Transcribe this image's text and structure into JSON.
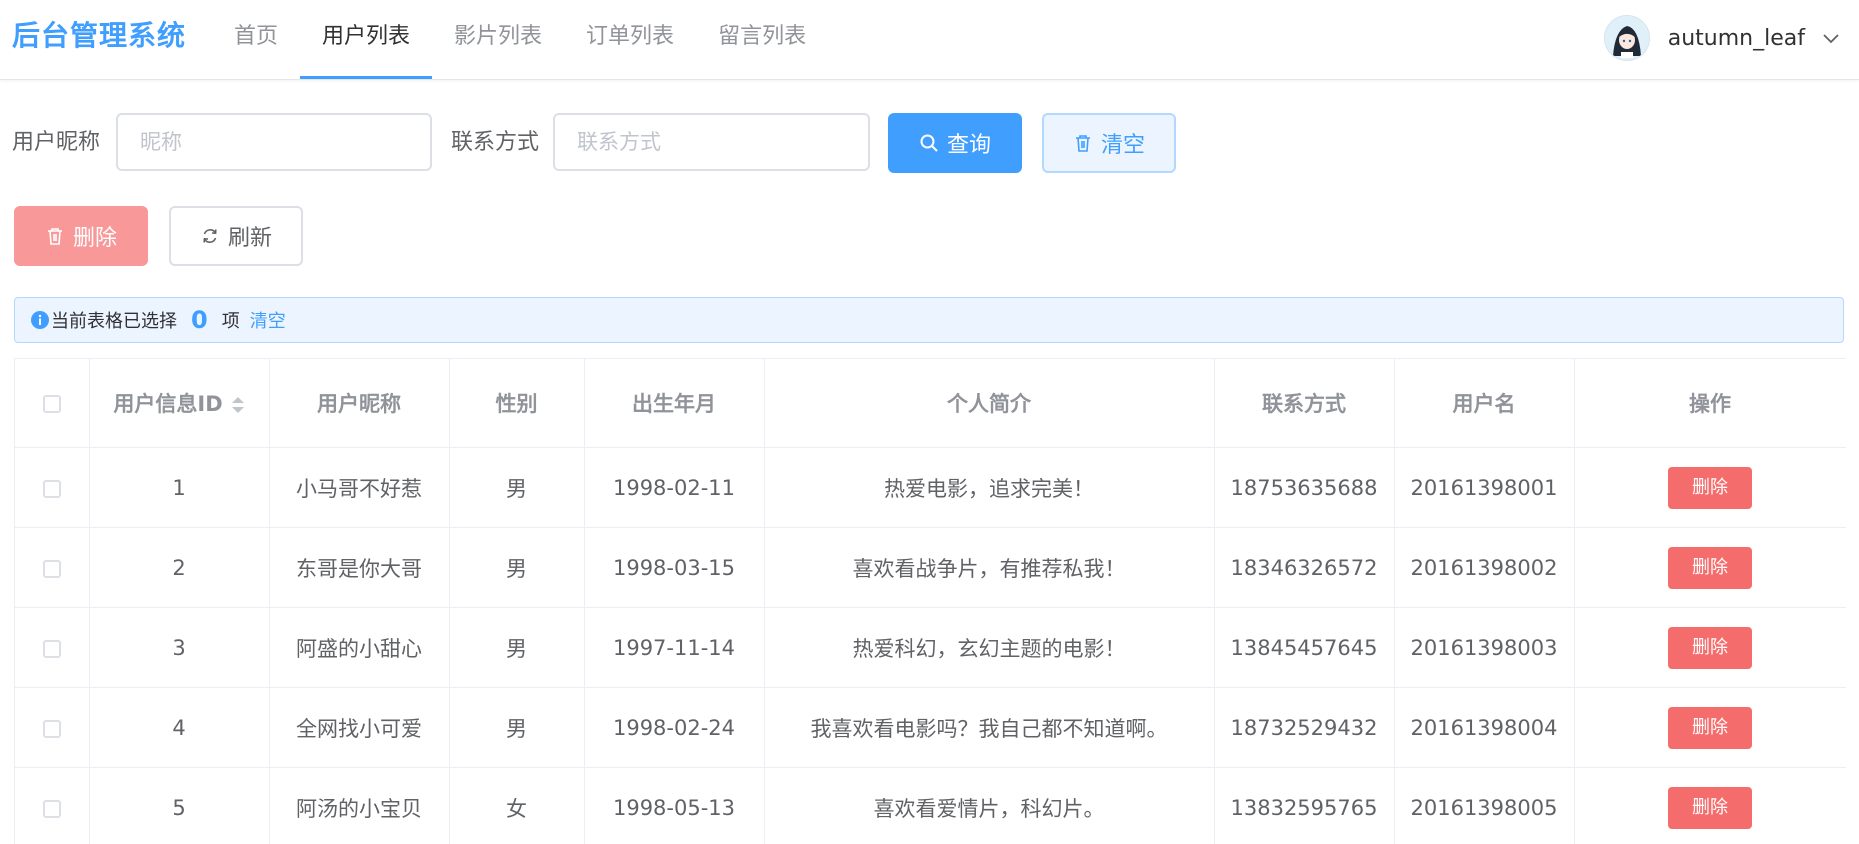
{
  "header": {
    "brand": "后台管理系统",
    "nav": [
      {
        "label": "首页",
        "active": false
      },
      {
        "label": "用户列表",
        "active": true
      },
      {
        "label": "影片列表",
        "active": false
      },
      {
        "label": "订单列表",
        "active": false
      },
      {
        "label": "留言列表",
        "active": false
      }
    ],
    "username": "autumn_leaf"
  },
  "search": {
    "nickname_label": "用户昵称",
    "nickname_placeholder": "昵称",
    "nickname_value": "",
    "contact_label": "联系方式",
    "contact_placeholder": "联系方式",
    "contact_value": "",
    "query_button": "查询",
    "clear_button": "清空"
  },
  "toolbar": {
    "delete_button": "删除",
    "refresh_button": "刷新"
  },
  "selection": {
    "prefix": "当前表格已选择",
    "count": "0",
    "suffix": "项",
    "clear_link": "清空"
  },
  "table": {
    "columns": [
      "用户信息ID",
      "用户昵称",
      "性别",
      "出生年月",
      "个人简介",
      "联系方式",
      "用户名",
      "操作"
    ],
    "delete_label": "删除",
    "rows": [
      {
        "id": "1",
        "nickname": "小马哥不好惹",
        "gender": "男",
        "birth": "1998-02-11",
        "bio": "热爱电影，追求完美！",
        "contact": "18753635688",
        "username": "20161398001"
      },
      {
        "id": "2",
        "nickname": "东哥是你大哥",
        "gender": "男",
        "birth": "1998-03-15",
        "bio": "喜欢看战争片，有推荐私我！",
        "contact": "18346326572",
        "username": "20161398002"
      },
      {
        "id": "3",
        "nickname": "阿盛的小甜心",
        "gender": "男",
        "birth": "1997-11-14",
        "bio": "热爱科幻，玄幻主题的电影！",
        "contact": "13845457645",
        "username": "20161398003"
      },
      {
        "id": "4",
        "nickname": "全网找小可爱",
        "gender": "男",
        "birth": "1998-02-24",
        "bio": "我喜欢看电影吗？我自己都不知道啊。",
        "contact": "18732529432",
        "username": "20161398004"
      },
      {
        "id": "5",
        "nickname": "阿汤的小宝贝",
        "gender": "女",
        "birth": "1998-05-13",
        "bio": "喜欢看爱情片，科幻片。",
        "contact": "13832595765",
        "username": "20161398005"
      }
    ]
  },
  "colors": {
    "primary": "#409eff",
    "danger": "#f56c6c",
    "danger_disabled": "#f89898",
    "header_text": "#909399"
  }
}
